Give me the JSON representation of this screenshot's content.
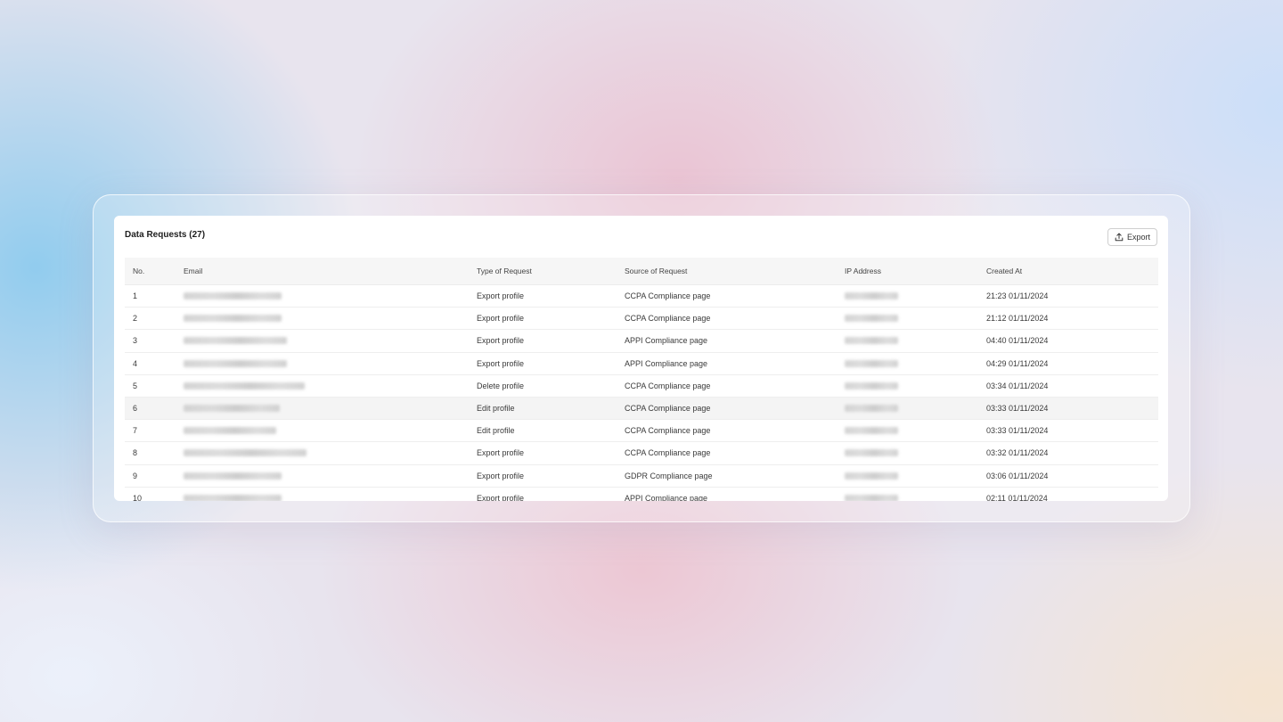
{
  "panel": {
    "title": "Data Requests (27)",
    "export_label": "Export",
    "icons": {
      "export": "upload-icon"
    }
  },
  "table": {
    "columns": [
      "No.",
      "Email",
      "Type of Request",
      "Source of Request",
      "IP Address",
      "Created At"
    ],
    "rows": [
      {
        "no": "1",
        "type": "Export profile",
        "source": "CCPA Compliance page",
        "created": "21:23 01/11/2024"
      },
      {
        "no": "2",
        "type": "Export profile",
        "source": "CCPA Compliance page",
        "created": "21:12 01/11/2024"
      },
      {
        "no": "3",
        "type": "Export profile",
        "source": "APPI Compliance page",
        "created": "04:40 01/11/2024"
      },
      {
        "no": "4",
        "type": "Export profile",
        "source": "APPI Compliance page",
        "created": "04:29 01/11/2024"
      },
      {
        "no": "5",
        "type": "Delete profile",
        "source": "CCPA Compliance page",
        "created": "03:34 01/11/2024"
      },
      {
        "no": "6",
        "type": "Edit profile",
        "source": "CCPA Compliance page",
        "created": "03:33 01/11/2024"
      },
      {
        "no": "7",
        "type": "Edit profile",
        "source": "CCPA Compliance page",
        "created": "03:33 01/11/2024"
      },
      {
        "no": "8",
        "type": "Export profile",
        "source": "CCPA Compliance page",
        "created": "03:32 01/11/2024"
      },
      {
        "no": "9",
        "type": "Export profile",
        "source": "GDPR Compliance page",
        "created": "03:06 01/11/2024"
      },
      {
        "no": "10",
        "type": "Export profile",
        "source": "APPI Compliance page",
        "created": "02:11 01/11/2024"
      }
    ]
  }
}
